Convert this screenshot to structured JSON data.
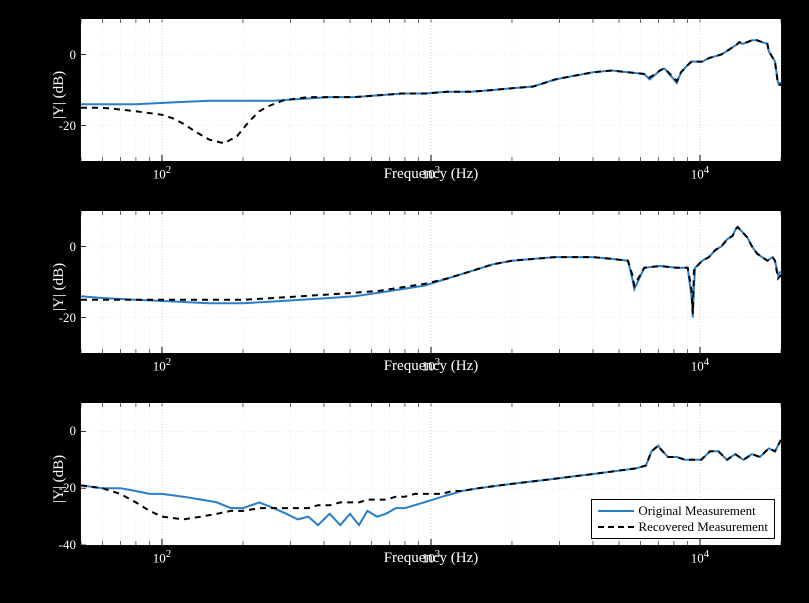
{
  "chart_data": [
    {
      "type": "line",
      "xlabel": "Frequency (Hz)",
      "ylabel": "|Y| (dB)",
      "xscale": "log",
      "xlim": [
        50,
        20000
      ],
      "ylim": [
        -30,
        10
      ],
      "xticks": [
        100,
        1000,
        10000
      ],
      "xticklabels": [
        "10^2",
        "10^3",
        "10^4"
      ],
      "yticks": [
        -20,
        0
      ],
      "legend": null,
      "series": [
        {
          "name": "Original Measurement",
          "color": "#2a7ec8",
          "dash": "solid",
          "x": [
            50,
            60,
            80,
            110,
            150,
            200,
            260,
            330,
            420,
            520,
            640,
            780,
            950,
            1150,
            1400,
            1700,
            2000,
            2400,
            2900,
            3400,
            4000,
            4700,
            5400,
            6200,
            6500,
            7100,
            7300,
            7400,
            8200,
            8500,
            9000,
            9300,
            9700,
            10200,
            10800,
            11400,
            12000,
            12600,
            13200,
            13800,
            14000,
            14400,
            15000,
            15600,
            16300,
            17000,
            17800,
            18000,
            19000,
            19500,
            20000
          ],
          "y": [
            -14,
            -14,
            -14,
            -13.5,
            -13,
            -13,
            -13,
            -12.5,
            -12,
            -12,
            -11.5,
            -11,
            -11,
            -10.5,
            -10.5,
            -10,
            -9.5,
            -9,
            -7,
            -6,
            -5,
            -4.5,
            -5,
            -5.5,
            -7,
            -4.5,
            -4,
            -4,
            -8,
            -5,
            -3,
            -2,
            -2,
            -2,
            -1,
            -0.5,
            0,
            1,
            2,
            3,
            3.5,
            3,
            3.5,
            4,
            4,
            3.5,
            3,
            1,
            -2,
            -8,
            -8
          ]
        },
        {
          "name": "Recovered Measurement",
          "color": "#000000",
          "dash": "6,5",
          "x": [
            50,
            60,
            70,
            80,
            90,
            100,
            110,
            120,
            135,
            150,
            170,
            190,
            210,
            230,
            250,
            280,
            310,
            350,
            420,
            520,
            640,
            780,
            950,
            1150,
            1400,
            1700,
            2000,
            2400,
            2900,
            3400,
            4000,
            4700,
            5400,
            6200,
            6500,
            7100,
            7300,
            7400,
            8200,
            8500,
            9000,
            9300,
            9700,
            10200,
            10800,
            11400,
            12000,
            12600,
            13200,
            13800,
            14000,
            14400,
            15000,
            15600,
            16300,
            17000,
            17800,
            18000,
            19000,
            19500,
            20000
          ],
          "y": [
            -15,
            -15,
            -15.5,
            -16,
            -16.5,
            -17,
            -18,
            -19.5,
            -22,
            -24,
            -25,
            -23,
            -19,
            -16,
            -14.5,
            -13,
            -12.5,
            -12,
            -12,
            -12,
            -11.5,
            -11,
            -11,
            -10.5,
            -10.5,
            -10,
            -9.5,
            -9,
            -7,
            -6,
            -5,
            -4.5,
            -5,
            -5.5,
            -6.5,
            -4.5,
            -4,
            -4,
            -7.5,
            -5,
            -3,
            -2,
            -2,
            -2,
            -1,
            -0.5,
            0,
            1,
            2,
            3,
            3.5,
            3,
            3.5,
            4,
            4,
            3.5,
            3,
            1,
            -2,
            -8.5,
            -8.5
          ]
        }
      ]
    },
    {
      "type": "line",
      "xlabel": "Frequency (Hz)",
      "ylabel": "|Y| (dB)",
      "xscale": "log",
      "xlim": [
        50,
        20000
      ],
      "ylim": [
        -30,
        10
      ],
      "xticks": [
        100,
        1000,
        10000
      ],
      "xticklabels": [
        "10^2",
        "10^3",
        "10^4"
      ],
      "yticks": [
        -20,
        0
      ],
      "legend": null,
      "series": [
        {
          "name": "Original Measurement",
          "color": "#2a7ec8",
          "dash": "solid",
          "x": [
            50,
            60,
            80,
            110,
            150,
            200,
            260,
            330,
            420,
            520,
            640,
            780,
            950,
            1150,
            1400,
            1700,
            2000,
            2400,
            2900,
            3400,
            4000,
            4700,
            5400,
            5600,
            5700,
            6200,
            7100,
            8200,
            9000,
            9300,
            9400,
            9500,
            9600,
            10200,
            10800,
            11400,
            12000,
            12300,
            12600,
            13200,
            13400,
            13600,
            13800,
            14400,
            15000,
            15600,
            16300,
            17000,
            17800,
            18600,
            19000,
            19500,
            20000
          ],
          "y": [
            -14,
            -14.5,
            -15,
            -15.5,
            -16,
            -16,
            -15.5,
            -15,
            -14.5,
            -14,
            -13,
            -12,
            -11,
            -9,
            -7,
            -5,
            -4,
            -3.5,
            -3,
            -3,
            -3,
            -3.5,
            -4,
            -9,
            -12,
            -6,
            -5.5,
            -6,
            -6,
            -14,
            -20,
            -11,
            -6,
            -4,
            -3,
            -1,
            0,
            1,
            2,
            3,
            4,
            5,
            5.5,
            4,
            2.5,
            0,
            -2,
            -3,
            -4,
            -3,
            -4,
            -8,
            -7
          ]
        },
        {
          "name": "Recovered Measurement",
          "color": "#000000",
          "dash": "6,5",
          "x": [
            50,
            60,
            80,
            110,
            150,
            200,
            260,
            330,
            420,
            520,
            640,
            780,
            950,
            1150,
            1400,
            1700,
            2000,
            2400,
            2900,
            3400,
            4000,
            4700,
            5400,
            5600,
            5700,
            6200,
            7100,
            8200,
            9000,
            9300,
            9400,
            9500,
            9600,
            10200,
            10800,
            11400,
            12000,
            12300,
            12600,
            13200,
            13400,
            13600,
            13800,
            14400,
            15000,
            15600,
            16300,
            17000,
            17800,
            18600,
            19000,
            19500,
            20000
          ],
          "y": [
            -15,
            -15,
            -15,
            -15,
            -15,
            -15,
            -14.5,
            -14,
            -13.5,
            -13,
            -12.5,
            -11.5,
            -10.5,
            -9,
            -7,
            -5,
            -4,
            -3.5,
            -3,
            -3,
            -3,
            -3.5,
            -4,
            -8,
            -11,
            -6,
            -5.5,
            -6,
            -6,
            -12,
            -19,
            -6,
            -6,
            -4,
            -3,
            -1,
            0,
            1,
            2,
            3,
            4,
            5,
            5.5,
            4,
            2.5,
            0,
            -2,
            -3,
            -4,
            -3,
            -4,
            -9,
            -8
          ]
        }
      ]
    },
    {
      "type": "line",
      "xlabel": "Frequency (Hz)",
      "ylabel": "|Y| (dB)",
      "xscale": "log",
      "xlim": [
        50,
        20000
      ],
      "ylim": [
        -40,
        10
      ],
      "xticks": [
        100,
        1000,
        10000
      ],
      "xticklabels": [
        "10^2",
        "10^3",
        "10^4"
      ],
      "yticks": [
        -40,
        -20,
        0
      ],
      "legend": {
        "position": "lower-right"
      },
      "series": [
        {
          "name": "Original Measurement",
          "color": "#2a7ec8",
          "dash": "solid",
          "x": [
            50,
            60,
            70,
            80,
            90,
            100,
            120,
            140,
            160,
            180,
            200,
            230,
            260,
            290,
            320,
            350,
            380,
            420,
            460,
            500,
            540,
            580,
            630,
            680,
            740,
            800,
            870,
            940,
            1020,
            1100,
            1200,
            1300,
            1500,
            1800,
            2200,
            2700,
            3300,
            4000,
            4800,
            5800,
            6300,
            6600,
            7000,
            7100,
            7600,
            8200,
            8800,
            9400,
            10100,
            10900,
            11700,
            12600,
            13500,
            14500,
            15600,
            16700,
            18000,
            19000,
            20000
          ],
          "y": [
            -19,
            -20,
            -20,
            -21,
            -22,
            -22,
            -23,
            -24,
            -25,
            -27,
            -27,
            -25,
            -27,
            -29,
            -31,
            -30,
            -33,
            -29,
            -33,
            -29,
            -33,
            -28,
            -30,
            -29,
            -27,
            -27,
            -26,
            -25,
            -24,
            -23,
            -22,
            -21,
            -20,
            -19,
            -18,
            -17,
            -16,
            -15,
            -14,
            -13,
            -12,
            -7,
            -5,
            -6,
            -9,
            -9,
            -10,
            -10,
            -10,
            -7,
            -7,
            -10,
            -8,
            -10,
            -8,
            -9,
            -6,
            -7,
            -3
          ]
        },
        {
          "name": "Recovered Measurement",
          "color": "#000000",
          "dash": "6,5",
          "x": [
            50,
            60,
            70,
            80,
            90,
            100,
            120,
            140,
            160,
            180,
            200,
            230,
            260,
            290,
            320,
            350,
            380,
            420,
            460,
            500,
            540,
            580,
            630,
            680,
            740,
            800,
            870,
            940,
            1020,
            1100,
            1200,
            1300,
            1500,
            1800,
            2200,
            2700,
            3300,
            4000,
            4800,
            5800,
            6300,
            6600,
            7000,
            7100,
            7600,
            8200,
            8800,
            9400,
            10100,
            10900,
            11700,
            12600,
            13500,
            14500,
            15600,
            16700,
            18000,
            19000,
            20000
          ],
          "y": [
            -19,
            -20,
            -22,
            -25,
            -28,
            -30,
            -31,
            -30,
            -29,
            -28,
            -28,
            -27,
            -27,
            -27,
            -27,
            -27,
            -26,
            -26,
            -25,
            -25,
            -25,
            -24,
            -24,
            -24,
            -23,
            -23,
            -22,
            -22,
            -22,
            -22,
            -21,
            -21,
            -20,
            -19,
            -18,
            -17,
            -16,
            -15,
            -14,
            -13,
            -12,
            -7,
            -5,
            -6,
            -9,
            -9,
            -10,
            -10,
            -10,
            -7,
            -7,
            -10,
            -8,
            -10,
            -8,
            -9,
            -6,
            -7,
            -3
          ]
        }
      ]
    }
  ],
  "legend_labels": {
    "original": "Original Measurement",
    "recovered": "Recovered Measurement"
  },
  "axis_labels": {
    "x": "Frequency (Hz)",
    "y": "|Y| (dB)"
  }
}
